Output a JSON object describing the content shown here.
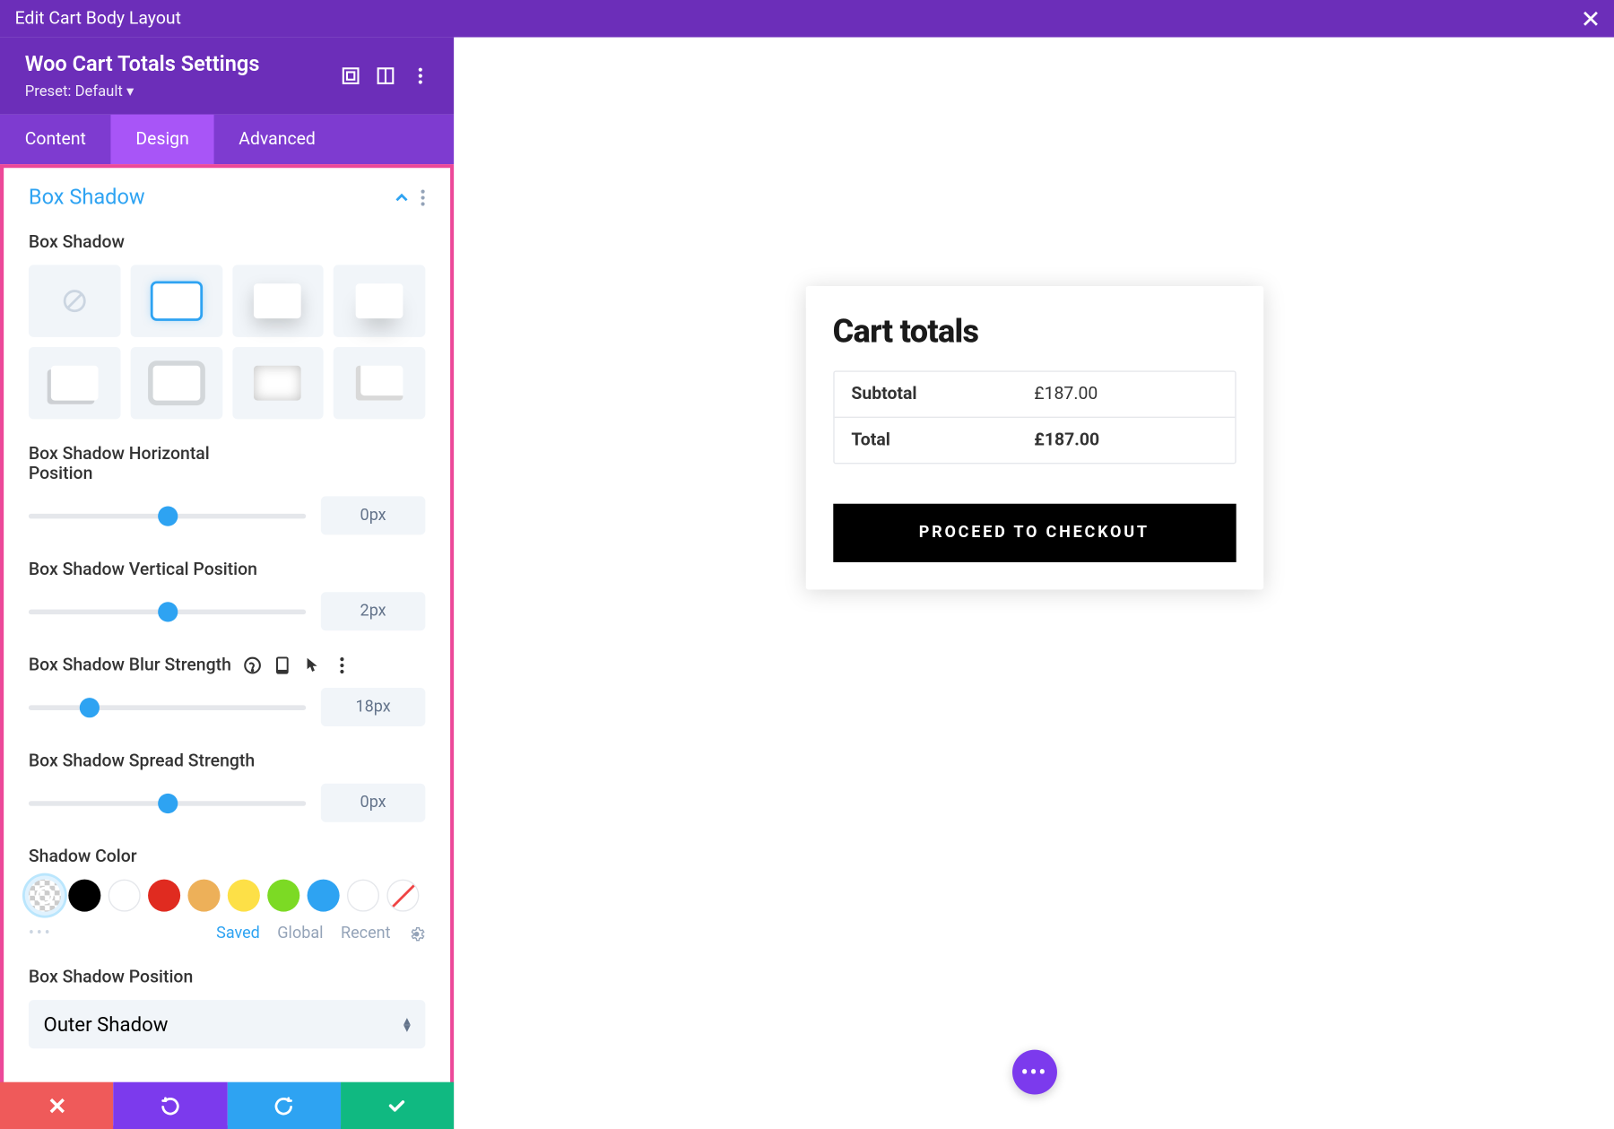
{
  "topbar": {
    "title": "Edit Cart Body Layout"
  },
  "sidebar": {
    "title": "Woo Cart Totals Settings",
    "preset": "Preset: Default",
    "tabs": [
      "Content",
      "Design",
      "Advanced"
    ],
    "active_tab": 1
  },
  "section": {
    "title": "Box Shadow",
    "presets_label": "Box Shadow",
    "sliders": {
      "horizontal": {
        "label": "Box Shadow Horizontal Position",
        "value": "0px",
        "pos": 50
      },
      "vertical": {
        "label": "Box Shadow Vertical Position",
        "value": "2px",
        "pos": 50
      },
      "blur": {
        "label": "Box Shadow Blur Strength",
        "value": "18px",
        "pos": 22
      },
      "spread": {
        "label": "Box Shadow Spread Strength",
        "value": "0px",
        "pos": 50
      }
    },
    "shadow_color_label": "Shadow Color",
    "colors": [
      "#000000",
      "#ffffff",
      "#e02b20",
      "#f59e0b",
      "#facc15",
      "#7cda24",
      "#2ea3f2",
      "#ffffff"
    ],
    "color_tabs": {
      "saved": "Saved",
      "global": "Global",
      "recent": "Recent"
    },
    "position_label": "Box Shadow Position",
    "position_value": "Outer Shadow"
  },
  "preview": {
    "cart_title": "Cart totals",
    "rows": [
      {
        "label": "Subtotal",
        "value": "£187.00"
      },
      {
        "label": "Total",
        "value": "£187.00"
      }
    ],
    "checkout_label": "PROCEED TO CHECKOUT"
  }
}
